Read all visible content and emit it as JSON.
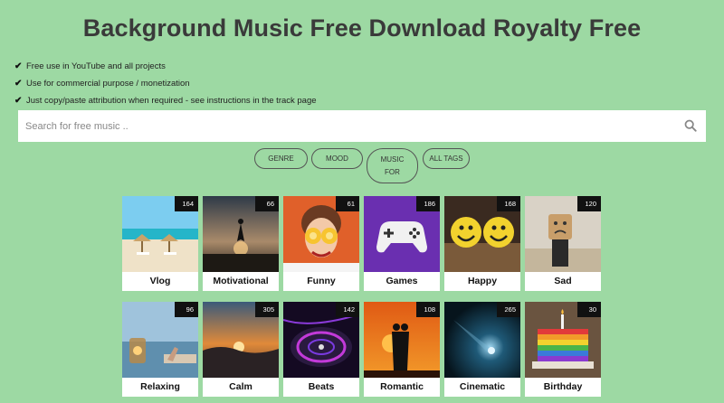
{
  "page": {
    "title": "Background Music Free Download Royalty Free"
  },
  "features": [
    "Free use in YouTube and all projects",
    "Use for commercial purpose / monetization",
    "Just copy/paste attribution when required - see instructions in the track page"
  ],
  "search": {
    "placeholder": "Search for free music .."
  },
  "filters": [
    {
      "label": "GENRE"
    },
    {
      "label": "MOOD"
    },
    {
      "label": "MUSIC FOR"
    },
    {
      "label": "ALL TAGS"
    }
  ],
  "categories": [
    {
      "label": "Vlog",
      "count": "164"
    },
    {
      "label": "Motivational",
      "count": "66"
    },
    {
      "label": "Funny",
      "count": "61"
    },
    {
      "label": "Games",
      "count": "186"
    },
    {
      "label": "Happy",
      "count": "168"
    },
    {
      "label": "Sad",
      "count": "120"
    },
    {
      "label": "Relaxing",
      "count": "96"
    },
    {
      "label": "Calm",
      "count": "305"
    },
    {
      "label": "Beats",
      "count": "142"
    },
    {
      "label": "Romantic",
      "count": "108"
    },
    {
      "label": "Cinematic",
      "count": "265"
    },
    {
      "label": "Birthday",
      "count": "30"
    }
  ]
}
